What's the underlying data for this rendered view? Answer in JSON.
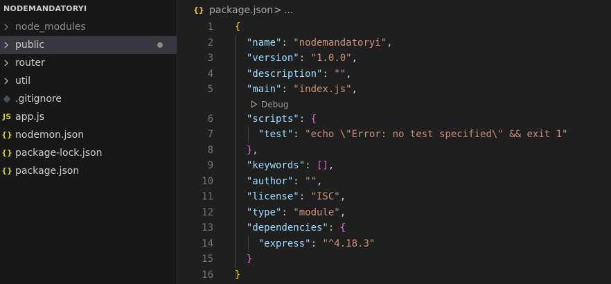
{
  "sidebar": {
    "title": "NODEMANDATORYI",
    "items": [
      {
        "label": "node_modules",
        "kind": "folder"
      },
      {
        "label": "public",
        "kind": "folder"
      },
      {
        "label": "router",
        "kind": "folder"
      },
      {
        "label": "util",
        "kind": "folder"
      },
      {
        "label": ".gitignore",
        "kind": "gitignore-icon"
      },
      {
        "label": "app.js",
        "kind": "js-icon",
        "icon_text": "JS"
      },
      {
        "label": "nodemon.json",
        "kind": "json-icon",
        "icon_text": "{}"
      },
      {
        "label": "package-lock.json",
        "kind": "json-icon",
        "icon_text": "{}"
      },
      {
        "label": "package.json",
        "kind": "json-icon",
        "icon_text": "{}"
      }
    ]
  },
  "breadcrumb": {
    "icon": "{}",
    "file": "package.json",
    "separator": ">",
    "more": "..."
  },
  "codelens": {
    "debug_label": "Debug"
  },
  "line_numbers": [
    "1",
    "2",
    "3",
    "4",
    "5",
    "6",
    "7",
    "8",
    "9",
    "10",
    "11",
    "12",
    "13",
    "14",
    "15",
    "16"
  ],
  "code": {
    "l1": "{",
    "name_key": "\"name\"",
    "name_val": "\"nodemandatoryi\"",
    "version_key": "\"version\"",
    "version_val": "\"1.0.0\"",
    "description_key": "\"description\"",
    "description_val": "\"\"",
    "main_key": "\"main\"",
    "main_val": "\"index.js\"",
    "scripts_key": "\"scripts\"",
    "open_brace": "{",
    "test_key": "\"test\"",
    "test_val": "\"echo \\\"Error: no test specified\\\" && exit 1\"",
    "close_scripts": "}",
    "keywords_key": "\"keywords\"",
    "keywords_val": "[]",
    "author_key": "\"author\"",
    "author_val": "\"\"",
    "license_key": "\"license\"",
    "license_val": "\"ISC\"",
    "type_key": "\"type\"",
    "type_val": "\"module\"",
    "dependencies_key": "\"dependencies\"",
    "express_key": "\"express\"",
    "express_val": "\"^4.18.3\"",
    "close_deps": "}",
    "close_root": "}"
  },
  "colors": {
    "background": "#1f1f1f",
    "sidebar_bg": "#181818",
    "selected_bg": "#37373d",
    "json_key": "#9cdcfe",
    "json_string": "#ce9178",
    "bracket_level1": "#ffd700",
    "bracket_level2": "#da70d6"
  }
}
